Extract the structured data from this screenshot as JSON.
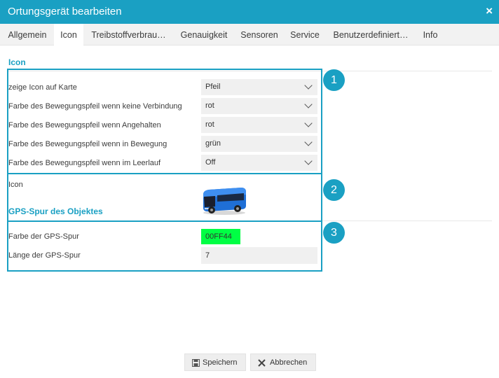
{
  "window": {
    "title": "Ortungsgerät bearbeiten",
    "close_glyph": "×"
  },
  "tabs": [
    {
      "label": "Allgemein"
    },
    {
      "label": "Icon",
      "active": true
    },
    {
      "label": "Treibstoffverbrau…"
    },
    {
      "label": "Genauigkeit"
    },
    {
      "label": "Sensoren"
    },
    {
      "label": "Service"
    },
    {
      "label": "Benutzerdefiniert…"
    },
    {
      "label": "Info"
    }
  ],
  "icon_section": {
    "title": "Icon",
    "rows": [
      {
        "label": "zeige Icon auf Karte",
        "value": "Pfeil"
      },
      {
        "label": "Farbe des Bewegungspfeil wenn keine Verbindung",
        "value": "rot"
      },
      {
        "label": "Farbe des Bewegungspfeil wenn Angehalten",
        "value": "rot"
      },
      {
        "label": "Farbe des Bewegungspfeil wenn in Bewegung",
        "value": "grün"
      },
      {
        "label": "Farbe des Bewegungspfeil wenn im Leerlauf",
        "value": "Off"
      }
    ],
    "icon_label": "Icon",
    "icon_image": "bus-icon"
  },
  "gps_section": {
    "title": "GPS-Spur des Objektes",
    "color_label": "Farbe der GPS-Spur",
    "color_value": "00FF44",
    "length_label": "Länge der GPS-Spur",
    "length_value": "7"
  },
  "annotations": {
    "badge1": "1",
    "badge2": "2",
    "badge3": "3"
  },
  "footer": {
    "save_label": "Speichern",
    "cancel_label": "Abbrechen"
  },
  "colors": {
    "accent": "#1aa0c3",
    "track_color": "#00FF44"
  }
}
